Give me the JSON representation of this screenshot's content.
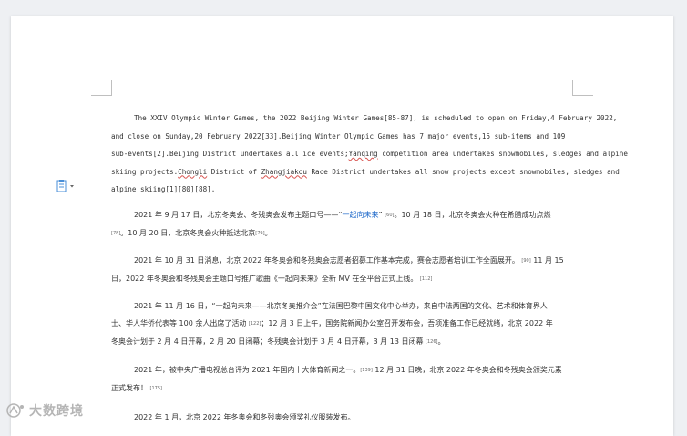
{
  "en_para": {
    "line1": "The XXIV Olympic Winter Games, the 2022 Beijing Winter Games[85-87], is scheduled to open on Friday,4 February 2022,",
    "line2": "and close on Sunday,20 February 2022[33].Beijing Winter Olympic Games has 7 major events,15 sub-items and 109",
    "line3_a": "sub-events[2].Beijing District undertakes all ice events;",
    "line3_b": "Yanqing",
    "line3_c": " competition area undertakes snowmobiles, sledges and alpine",
    "line4_a": "skiing projects.",
    "line4_b": "Chongli",
    "line4_c": " District of ",
    "line4_d": "Zhangjiakou",
    "line4_e": " Race District undertakes all snow projects except snowmobiles, sledges and",
    "line5": "alpine skiing[1][80][88]."
  },
  "p1": {
    "a": "2021 年 9 月 17 日，北京冬奥会、冬残奥会发布主题口号——“",
    "link": "一起向未来",
    "b": "”",
    "r1": "[60]",
    "c": "。10 月 18 日，北京冬奥会火种在希腊成功点燃",
    "r2": "[78]",
    "d": "。10 月 20 日，北京冬奥会火种抵达北京",
    "r3": "[79]",
    "e": "。"
  },
  "p2": {
    "a": "2021 年 10 月 31 日消息，北京 2022 年冬奥会和冬残奥会志愿者招募工作基本完成，赛会志愿者培训工作全面展开。",
    "r1": "[90]",
    "b": " 11 月 15",
    "c": "日，2022 年冬奥会和冬残奥会主题口号推广歌曲《一起向未来》全新 MV 在全平台正式上线。",
    "r2": "[112]"
  },
  "p3": {
    "a": "2021 年 11 月 16 日，“一起向未来——北京冬奥推介会”在法国巴黎中国文化中心举办，来自中法两国的文化、艺术和体育界人",
    "b": "士、华人华侨代表等 100 余人出席了活动",
    "r1": "[122]",
    "c": "；12 月 3 日上午，国务院新闻办公室召开发布会，吾项准备工作已经就绪，北京 2022 年",
    "d": "冬奥会计划于 2 月 4 日开幕，2 月 20 日闭幕；冬残奥会计划于 3 月 4 日开幕，3 月 13 日闭幕",
    "r2": "[126]",
    "e": "。"
  },
  "p4": {
    "a": "2021 年，被中央广播电视总台评为 2021 年国内十大体育新闻之一。",
    "r1": "[139]",
    "b": " 12 月 31 日晚，北京 2022 年冬奥会和冬残奥会颁奖元素",
    "c": "正式发布！",
    "r2": "[175]"
  },
  "p5": {
    "a": "2022 年 1 月，北京 2022 年冬奥会和冬残奥会颁奖礼仪服装发布。"
  },
  "watermark": {
    "text": "大数跨境"
  },
  "colors": {
    "link": "#1a66c8",
    "spellcheck": "#d9534f",
    "paste_icon": "#4a8fd8"
  }
}
